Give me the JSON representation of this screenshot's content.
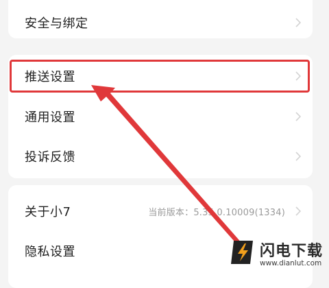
{
  "settings": {
    "items": [
      {
        "label": "安全与绑定"
      },
      {
        "label": "推送设置"
      },
      {
        "label": "通用设置"
      },
      {
        "label": "投诉反馈"
      },
      {
        "label": "关于小7",
        "value": "当前版本：5.35.0.10009(1334)"
      },
      {
        "label": "隐私设置"
      }
    ]
  },
  "watermark": {
    "title": "闪电下载",
    "url": "www.dianlut.com"
  },
  "colors": {
    "highlight": "#e0383a",
    "background": "#f4f4f4",
    "card": "#ffffff"
  },
  "icons": [
    "chevron-right-icon",
    "annotation-arrow",
    "watermark-logo-icon"
  ]
}
